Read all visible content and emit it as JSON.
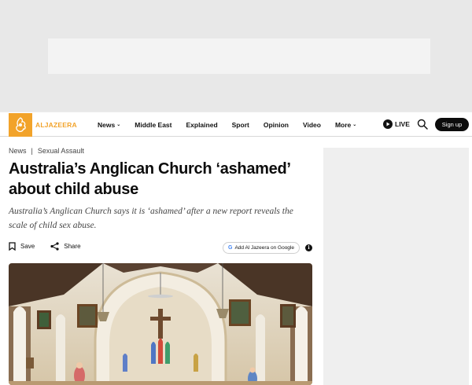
{
  "header": {
    "logo_text": "ALJAZEERA",
    "nav": [
      {
        "label": "News",
        "dropdown": true
      },
      {
        "label": "Middle East",
        "dropdown": false
      },
      {
        "label": "Explained",
        "dropdown": false
      },
      {
        "label": "Sport",
        "dropdown": false
      },
      {
        "label": "Opinion",
        "dropdown": false
      },
      {
        "label": "Video",
        "dropdown": false
      },
      {
        "label": "More",
        "dropdown": true
      }
    ],
    "live_label": "LIVE",
    "signup_label": "Sign up",
    "brand_color": "#f2a32a"
  },
  "breadcrumb": {
    "section": "News",
    "topic": "Sexual Assault"
  },
  "article": {
    "headline": "Australia’s Anglican Church ‘ashamed’ about child abuse",
    "subhead": "Australia’s Anglican Church says it is ‘ashamed’ after a new report reveals the scale of child sex abuse.",
    "save_label": "Save",
    "share_label": "Share",
    "google_label": "Add Al Jazeera on Google"
  },
  "icons": {
    "logo": "aljazeera-logo-icon",
    "live": "play-icon",
    "search": "search-icon",
    "save": "bookmark-icon",
    "share": "share-icon",
    "google": "google-g-icon",
    "info": "info-icon"
  }
}
